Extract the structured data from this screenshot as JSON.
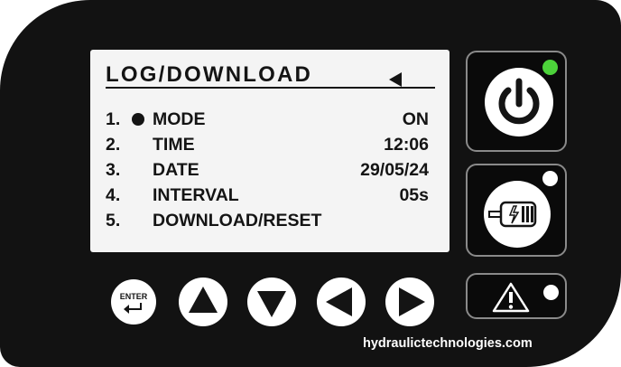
{
  "display": {
    "title": "LOG/DOWNLOAD",
    "back_icon": "triangle-left-icon",
    "rows": [
      {
        "number": "1.",
        "label": "MODE",
        "value": "ON",
        "selected": true
      },
      {
        "number": "2.",
        "label": "TIME",
        "value": "12:06",
        "selected": false
      },
      {
        "number": "3.",
        "label": "DATE",
        "value": "29/05/24",
        "selected": false
      },
      {
        "number": "4.",
        "label": "INTERVAL",
        "value": "05s",
        "selected": false
      },
      {
        "number": "5.",
        "label": "DOWNLOAD/RESET",
        "value": "",
        "selected": false
      }
    ]
  },
  "buttons": {
    "enter_label": "ENTER",
    "up_icon": "arrow-up-icon",
    "down_icon": "arrow-down-icon",
    "left_icon": "arrow-left-icon",
    "right_icon": "arrow-right-icon"
  },
  "side_buttons": {
    "power": {
      "icon": "power-icon",
      "led_color": "#4cd23a"
    },
    "motor": {
      "icon": "motor-icon",
      "led_color": "#ffffff"
    },
    "alarm": {
      "icon": "warning-icon",
      "led_color": "#ffffff"
    }
  },
  "footer": {
    "website": "hydraulictechnologies.com"
  },
  "colors": {
    "body": "#121212",
    "screen": "#f4f4f4",
    "text": "#141414"
  }
}
